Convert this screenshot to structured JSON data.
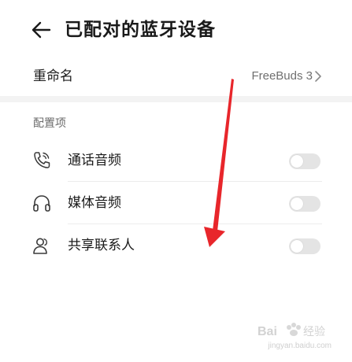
{
  "header": {
    "title": "已配对的蓝牙设备",
    "back_icon": "back-arrow-icon"
  },
  "rename": {
    "label": "重命名",
    "value": "FreeBuds 3"
  },
  "section": {
    "title": "配置项",
    "items": [
      {
        "label": "通话音频",
        "icon": "phone-call-icon",
        "enabled": false
      },
      {
        "label": "媒体音频",
        "icon": "headphones-icon",
        "enabled": false
      },
      {
        "label": "共享联系人",
        "icon": "contacts-icon",
        "enabled": false
      }
    ]
  },
  "annotation": {
    "arrow_color": "#e8262b"
  },
  "watermark": {
    "text": "Bai 经验",
    "url": "jingyan.baidu.com"
  }
}
